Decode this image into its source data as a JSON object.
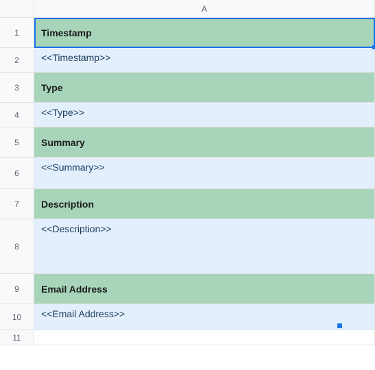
{
  "columns": {
    "A": "A"
  },
  "rows": {
    "r1": {
      "num": "1",
      "label": "Timestamp"
    },
    "r2": {
      "num": "2",
      "value": "<<Timestamp>>"
    },
    "r3": {
      "num": "3",
      "label": "Type"
    },
    "r4": {
      "num": "4",
      "value": "<<Type>>"
    },
    "r5": {
      "num": "5",
      "label": "Summary"
    },
    "r6": {
      "num": "6",
      "value": "<<Summary>>"
    },
    "r7": {
      "num": "7",
      "label": "Description"
    },
    "r8": {
      "num": "8",
      "value": "<<Description>>"
    },
    "r9": {
      "num": "9",
      "label": "Email Address"
    },
    "r10": {
      "num": "10",
      "value": "<<Email Address>>"
    },
    "r11": {
      "num": "11"
    }
  }
}
